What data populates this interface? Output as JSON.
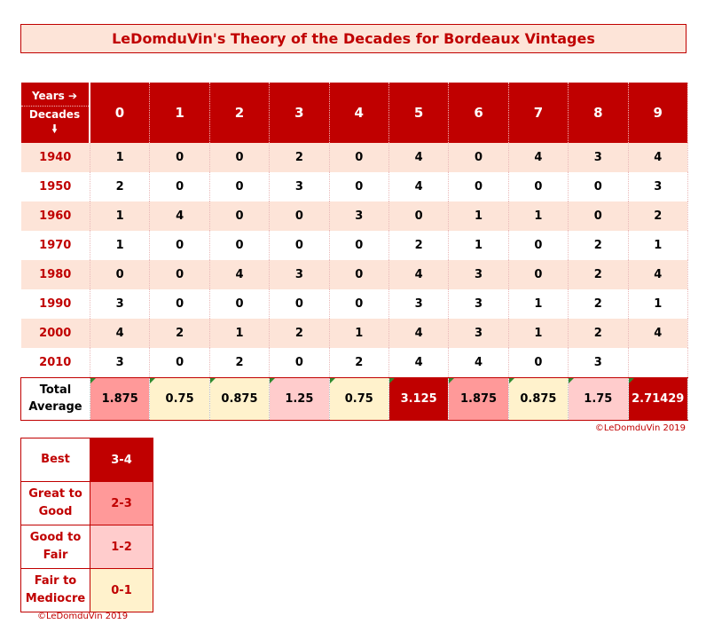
{
  "title": "LeDomduVin's Theory of the Decades for Bordeaux Vintages",
  "header": {
    "years_label": "Years ➔",
    "decades_label": "Decades",
    "decades_arrow": "🠛",
    "years": [
      "0",
      "1",
      "2",
      "3",
      "4",
      "5",
      "6",
      "7",
      "8",
      "9"
    ]
  },
  "rows": [
    {
      "decade": "1940",
      "values": [
        "1",
        "0",
        "0",
        "2",
        "0",
        "4",
        "0",
        "4",
        "3",
        "4"
      ]
    },
    {
      "decade": "1950",
      "values": [
        "2",
        "0",
        "0",
        "3",
        "0",
        "4",
        "0",
        "0",
        "0",
        "3"
      ]
    },
    {
      "decade": "1960",
      "values": [
        "1",
        "4",
        "0",
        "0",
        "3",
        "0",
        "1",
        "1",
        "0",
        "2"
      ]
    },
    {
      "decade": "1970",
      "values": [
        "1",
        "0",
        "0",
        "0",
        "0",
        "2",
        "1",
        "0",
        "2",
        "1"
      ]
    },
    {
      "decade": "1980",
      "values": [
        "0",
        "0",
        "4",
        "3",
        "0",
        "4",
        "3",
        "0",
        "2",
        "4"
      ]
    },
    {
      "decade": "1990",
      "values": [
        "3",
        "0",
        "0",
        "0",
        "0",
        "3",
        "3",
        "1",
        "2",
        "1"
      ]
    },
    {
      "decade": "2000",
      "values": [
        "4",
        "2",
        "1",
        "2",
        "1",
        "4",
        "3",
        "1",
        "2",
        "4"
      ]
    },
    {
      "decade": "2010",
      "values": [
        "3",
        "0",
        "2",
        "0",
        "2",
        "4",
        "4",
        "0",
        "3",
        ""
      ]
    }
  ],
  "average": {
    "label_line1": "Total",
    "label_line2": "Average",
    "values": [
      "1.875",
      "0.75",
      "0.875",
      "1.25",
      "0.75",
      "3.125",
      "1.875",
      "0.875",
      "1.75",
      "2.71429"
    ],
    "colors": [
      "#ff9999",
      "#fff2cc",
      "#fff2cc",
      "#ffcccc",
      "#fff2cc",
      "#c00000",
      "#ff9999",
      "#fff2cc",
      "#ffcccc",
      "#c00000"
    ],
    "text_colors": [
      "#000000",
      "#000000",
      "#000000",
      "#000000",
      "#000000",
      "#ffffff",
      "#000000",
      "#000000",
      "#000000",
      "#ffffff"
    ]
  },
  "copyright": "©LeDomduVin 2019",
  "legend": [
    {
      "label1": "Best",
      "label2": "",
      "range": "3-4",
      "color": "#c00000",
      "text_color": "#ffffff"
    },
    {
      "label1": "Great to",
      "label2": "Good",
      "range": "2-3",
      "color": "#ff9999",
      "text_color": "#c00000"
    },
    {
      "label1": "Good to",
      "label2": "Fair",
      "range": "1-2",
      "color": "#ffcccc",
      "text_color": "#c00000"
    },
    {
      "label1": "Fair to",
      "label2": "Mediocre",
      "range": "0-1",
      "color": "#fff2cc",
      "text_color": "#c00000"
    }
  ],
  "legend_copyright": "©LeDomduVin 2019"
}
